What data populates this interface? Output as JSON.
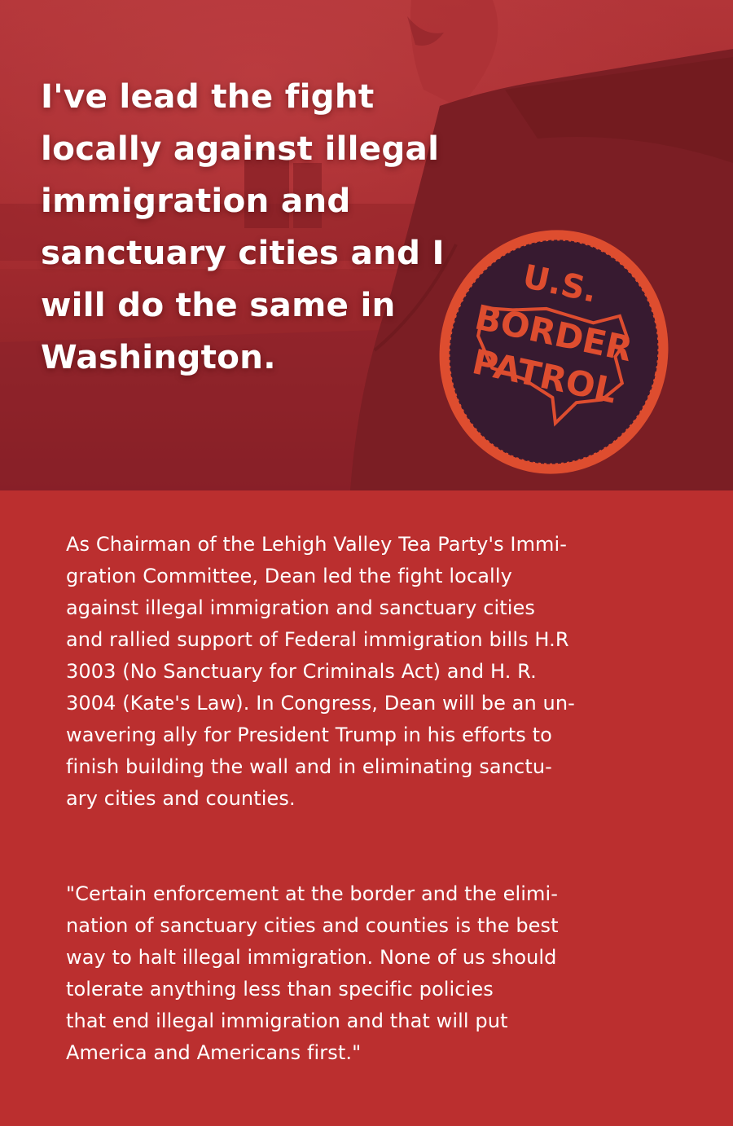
{
  "hero": {
    "headline_lines": [
      "I've lead the fight",
      "locally against illegal",
      "immigration and",
      "sanctuary cities and I",
      "will do the same in",
      "Washington."
    ],
    "patch": {
      "line1": "U.S.",
      "line2": "BORDER",
      "line3": "PATROL"
    }
  },
  "body": {
    "paragraph_1_lines": [
      "As Chairman of the Lehigh Valley Tea Party's Immi-",
      "gration Committee, Dean led the fight locally",
      "against illegal immigration and sanctuary cities",
      "and rallied support of Federal immigration bills H.R",
      "3003 (No Sanctuary for Criminals Act) and H. R.",
      "3004 (Kate's Law). In Congress, Dean will be an un-",
      "wavering ally for President Trump in his efforts to",
      "finish building the wall and in eliminating sanctu-",
      "ary cities and counties."
    ],
    "paragraph_2_lines": [
      "\"Certain enforcement at the border and the elimi-",
      "nation of sanctuary cities and counties is the best",
      "way to halt illegal immigration. None of us should",
      "tolerate anything less than specific policies",
      "that end illegal immigration and that will put",
      "America and Americans first.\""
    ]
  },
  "colors": {
    "brand_red": "#bb2f2f",
    "hero_overlay": "#9a2428",
    "text": "#ffffff",
    "patch_orange": "#e8552f",
    "patch_navy": "#1d1630"
  }
}
